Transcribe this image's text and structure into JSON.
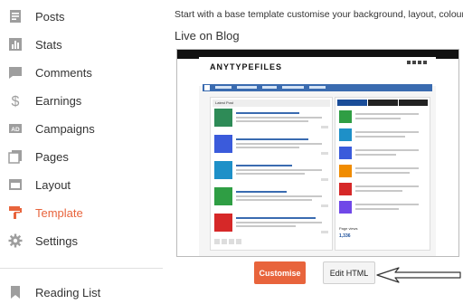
{
  "sidebar": {
    "items": [
      {
        "label": "Posts",
        "icon": "posts-icon",
        "active": false
      },
      {
        "label": "Stats",
        "icon": "stats-icon",
        "active": false
      },
      {
        "label": "Comments",
        "icon": "comments-icon",
        "active": false
      },
      {
        "label": "Earnings",
        "icon": "dollar-icon",
        "active": false
      },
      {
        "label": "Campaigns",
        "icon": "campaigns-icon",
        "active": false
      },
      {
        "label": "Pages",
        "icon": "pages-icon",
        "active": false
      },
      {
        "label": "Layout",
        "icon": "layout-icon",
        "active": false
      },
      {
        "label": "Template",
        "icon": "template-icon",
        "active": true
      },
      {
        "label": "Settings",
        "icon": "gear-icon",
        "active": false
      }
    ],
    "reading_list": {
      "label": "Reading List",
      "icon": "bookmark-icon"
    }
  },
  "main": {
    "intro_text": "Start with a base template customise your background, layout, colours,",
    "live_title": "Live on Blog",
    "preview": {
      "brand": "ANYTYPEFILES",
      "tagline": "",
      "latest_header": "Latest Post",
      "pageviews_label": "Page views",
      "pageviews_count": "1,336"
    },
    "buttons": {
      "customise": "Customise",
      "edit_html": "Edit HTML"
    }
  },
  "colors": {
    "accent": "#e8643c",
    "icon_grey": "#9e9e9e",
    "nav_blue": "#3a6bb0"
  }
}
